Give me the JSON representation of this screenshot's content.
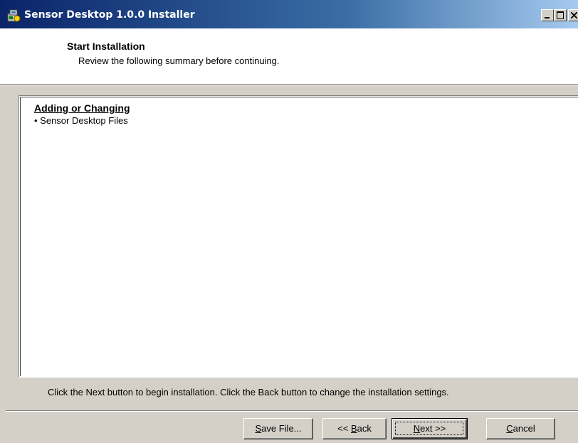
{
  "window": {
    "title": "Sensor Desktop 1.0.0 Installer",
    "app_icon": "installer-icon",
    "colors": {
      "titlebar_start": "#0a246a",
      "titlebar_end": "#a6caf0",
      "face": "#d4d0c8"
    }
  },
  "header": {
    "title": "Start Installation",
    "subtitle": "Review the following summary before continuing."
  },
  "summary": {
    "heading": "Adding or Changing",
    "items": [
      "• Sensor Desktop Files"
    ]
  },
  "instruction": "Click the Next button to begin installation.  Click the Back button to change the installation settings.",
  "buttons": {
    "save_mnemonic": "S",
    "save_rest": "ave File...",
    "back_prefix": "<< ",
    "back_mnemonic": "B",
    "back_rest": "ack",
    "next_mnemonic": "N",
    "next_rest": "ext >>",
    "cancel_mnemonic": "C",
    "cancel_rest": "ancel"
  }
}
